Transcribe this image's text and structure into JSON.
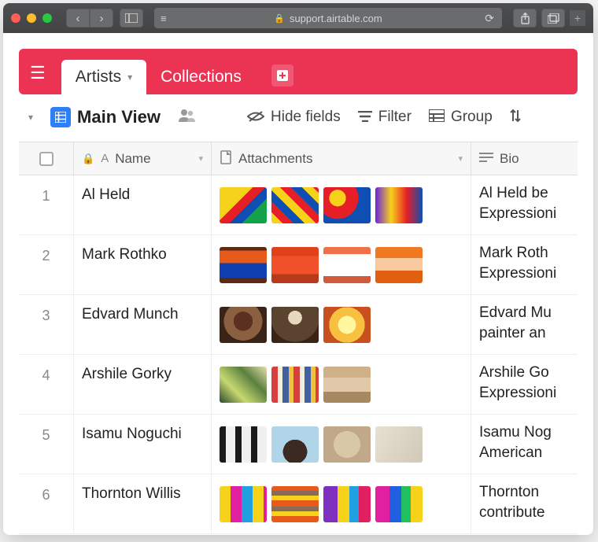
{
  "browser": {
    "url": "support.airtable.com"
  },
  "tabs": [
    "Artists",
    "Collections"
  ],
  "toolbar": {
    "view_name": "Main View",
    "hide_fields": "Hide fields",
    "filter": "Filter",
    "group": "Group"
  },
  "columns": {
    "name": "Name",
    "attachments": "Attachments",
    "bio": "Bio"
  },
  "rows": [
    {
      "n": "1",
      "name": "Al Held",
      "bio1": "Al Held be",
      "bio2": "Expressioni",
      "thumbs": [
        "t1",
        "t2",
        "t3",
        "t4"
      ]
    },
    {
      "n": "2",
      "name": "Mark Rothko",
      "bio1": "Mark Roth",
      "bio2": "Expressioni",
      "thumbs": [
        "r1",
        "r2",
        "r3",
        "r4"
      ]
    },
    {
      "n": "3",
      "name": "Edvard Munch",
      "bio1": "Edvard Mu",
      "bio2": "painter an",
      "thumbs": [
        "m1",
        "m2",
        "m3"
      ]
    },
    {
      "n": "4",
      "name": "Arshile Gorky",
      "bio1": "Arshile Go",
      "bio2": "Expressioni",
      "thumbs": [
        "g1",
        "g2",
        "g3"
      ]
    },
    {
      "n": "5",
      "name": "Isamu Noguchi",
      "bio1": "Isamu Nog",
      "bio2": "American",
      "thumbs": [
        "n1",
        "n2",
        "n3",
        "n4"
      ]
    },
    {
      "n": "6",
      "name": "Thornton Willis",
      "bio1": "Thornton ",
      "bio2": "contribute",
      "thumbs": [
        "w1",
        "w2",
        "w3",
        "w4"
      ]
    }
  ]
}
